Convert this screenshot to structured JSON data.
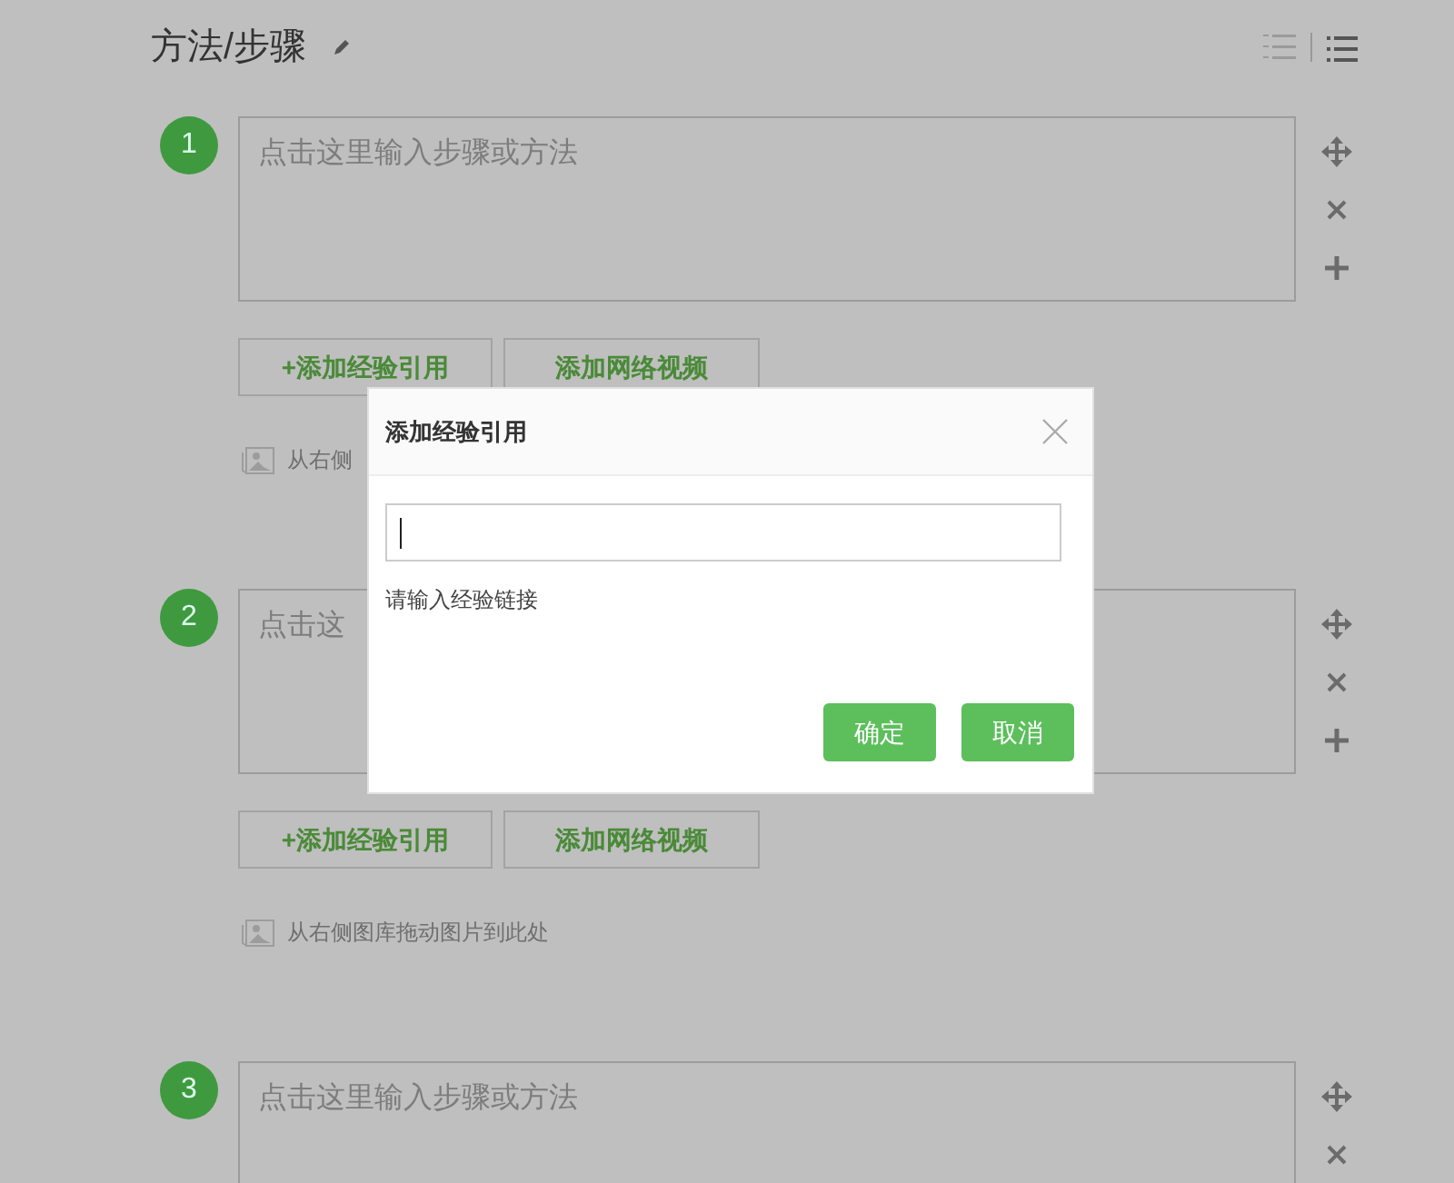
{
  "section": {
    "title": "方法/步骤"
  },
  "steps": [
    {
      "number": "1",
      "placeholder": "点击这里输入步骤或方法",
      "buttons": [
        "+添加经验引用",
        "添加网络视频"
      ],
      "image_hint": "从右侧"
    },
    {
      "number": "2",
      "placeholder": "点击这",
      "buttons": [
        "+添加经验引用",
        "添加网络视频"
      ],
      "image_hint": "从右侧图库拖动图片到此处"
    },
    {
      "number": "3",
      "placeholder": "点击这里输入步骤或方法"
    }
  ],
  "dialog": {
    "title": "添加经验引用",
    "hint": "请输入经验链接",
    "buttons": [
      "确定",
      "取消"
    ]
  }
}
